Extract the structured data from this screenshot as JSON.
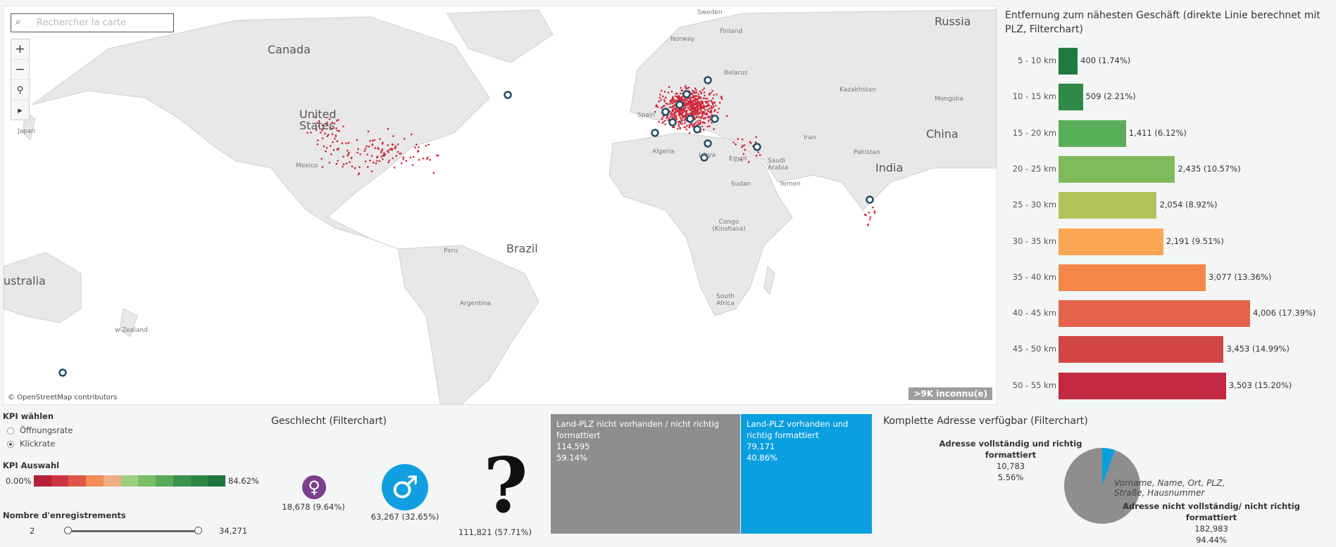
{
  "map": {
    "search_placeholder": "Rechercher la carte",
    "zoom_in": "+",
    "zoom_out": "−",
    "pin": "pin-icon",
    "play": "▸",
    "credit": "© OpenStreetMap contributors",
    "unknown_badge": ">9K inconnu(e)",
    "labels": {
      "canada": "Canada",
      "united_states": "United States",
      "mexico": "Mexico",
      "brazil": "Brazil",
      "peru": "Peru",
      "argentina": "Argentina",
      "russia": "Russia",
      "china": "China",
      "india": "India",
      "kazakhstan": "Kazakhstan",
      "mongolia": "Mongolia",
      "iran": "Iran",
      "pakistan": "Pakistan",
      "algeria": "Algeria",
      "libya": "Libya",
      "egypt": "Egypt",
      "sudan": "Sudan",
      "saudi_arabia": "Saudi Arabia",
      "yemen": "Yemen",
      "congo": "Congo (Kinshasa)",
      "south_africa": "South Africa",
      "japan": "Japan",
      "australia": "ustralia",
      "new_zealand": "w Zealand",
      "sweden": "Sweden",
      "norway": "Norway",
      "finland": "Finland",
      "belarus": "Belarus",
      "spain": "Spain"
    }
  },
  "bar_chart": {
    "title": "Entfernung zum nähesten Geschäft (direkte Linie berechnet mit PLZ, Filterchart)",
    "colors": [
      "#1e7a3e",
      "#2f8a47",
      "#59ae5a",
      "#80ba5b",
      "#b0c35b",
      "#fba652",
      "#f5864a",
      "#e4634a",
      "#d24745",
      "#c2283f"
    ],
    "chart_data": {
      "type": "bar",
      "orientation": "horizontal",
      "categories": [
        "5 - 10 km",
        "10 - 15 km",
        "15 - 20 km",
        "20 - 25 km",
        "25 - 30 km",
        "30 - 35 km",
        "35 - 40 km",
        "40 - 45 km",
        "45 - 50 km",
        "50 - 55 km"
      ],
      "values": [
        400,
        509,
        1411,
        2435,
        2054,
        2191,
        3077,
        4006,
        3453,
        3503
      ],
      "labels": [
        "400",
        "509",
        "1,411",
        "2,435",
        "2,054",
        "2,191",
        "3,077",
        "4,006",
        "3,453",
        "3,503"
      ],
      "percents": [
        "(1.74%)",
        "(2.21%)",
        "(6.12%)",
        "(10.57%)",
        "(8.92%)",
        "(9.51%)",
        "(13.36%)",
        "(17.39%)",
        "(14.99%)",
        "(15.20%)"
      ],
      "xlim": [
        0,
        4006
      ]
    }
  },
  "kpi": {
    "title": "KPI wählen",
    "options": [
      "Öffnungsrate",
      "Klickrate"
    ],
    "selected": "Klickrate",
    "legend_title": "KPI Auswahl",
    "min": "0.00%",
    "max": "84.62%",
    "colors": [
      "#b4203c",
      "#cf3446",
      "#e05748",
      "#f18d55",
      "#f3ad86",
      "#9ccf7e",
      "#7abf62",
      "#5aa95a",
      "#3d9150",
      "#2e8546",
      "#1f7440"
    ]
  },
  "records": {
    "title": "Nombre d'enregistrements",
    "min": "2",
    "max": "34,271"
  },
  "gender": {
    "title": "Geschlecht (Filterchart)",
    "female": {
      "icon": "female-icon",
      "value": "18,678",
      "pct": "(9.64%)",
      "color": "#7b3f8c"
    },
    "male": {
      "icon": "male-icon",
      "value": "63,267",
      "pct": "(32.65%)",
      "color": "#109fe0"
    },
    "unknown": {
      "icon": "question-icon",
      "value": "111,821",
      "pct": "(57.71%)"
    }
  },
  "treemap": {
    "left": {
      "line1": "Land-PLZ nicht vorhanden / nicht richtig",
      "line2": "formattiert",
      "value": "114,595",
      "pct": "59.14%",
      "color": "#8e8e8e"
    },
    "right": {
      "line1": "Land-PLZ vorhanden und",
      "line2": "richtig formattiert",
      "value": "79,171",
      "pct": "40.86%",
      "color": "#0a9fde"
    }
  },
  "address": {
    "title": "Komplette Adresse verfügbar (Filterchart)",
    "complete_label": "Adresse vollständig und richtig formattiert",
    "complete_value": "10,783",
    "complete_pct": "5.56%",
    "inner_line1": "Vorname, Name, Ort, PLZ,",
    "inner_line2": "Straße, Hausnummer",
    "incomplete_label": "Adresse nicht vollständig/ nicht richtig formattiert",
    "incomplete_value": "182,983",
    "incomplete_pct": "94.44%",
    "chart_data": {
      "type": "pie",
      "categories": [
        "Adresse vollständig und richtig formattiert",
        "Adresse nicht vollständig/ nicht richtig formattiert"
      ],
      "values": [
        10783,
        182983
      ],
      "colors": [
        "#0a9fde",
        "#8e8e8e"
      ]
    }
  }
}
